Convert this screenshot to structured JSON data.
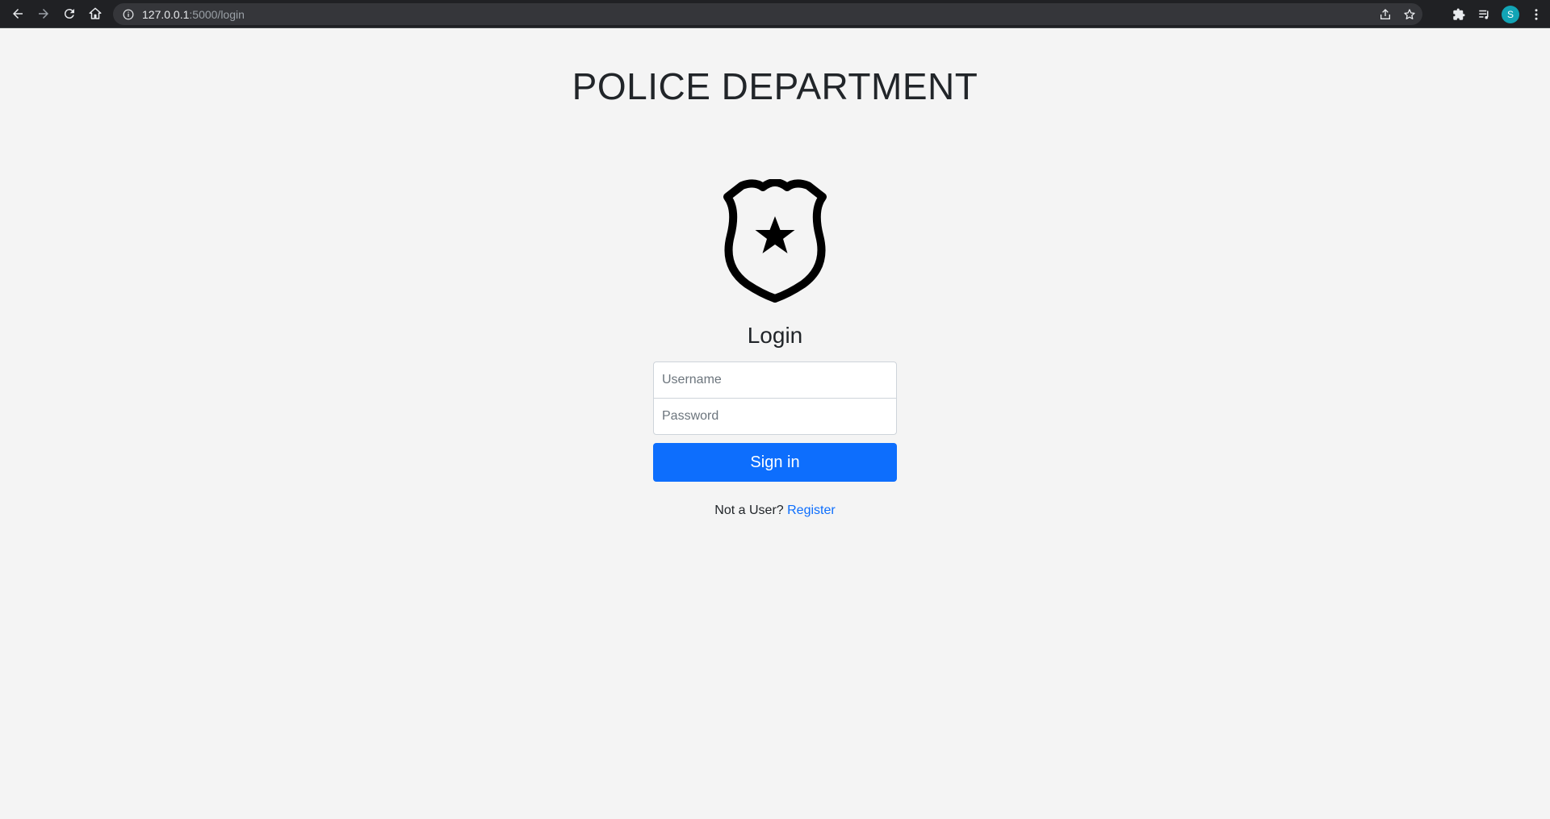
{
  "browser": {
    "url_host": "127.0.0.1",
    "url_path": ":5000/login",
    "profile_initial": "S",
    "icons": [
      "back-icon",
      "forward-icon",
      "reload-icon",
      "home-icon",
      "info-icon",
      "share-icon",
      "star-icon",
      "extensions-icon",
      "media-icon",
      "menu-icon"
    ]
  },
  "page": {
    "title": "POLICE DEPARTMENT",
    "logo_icon": "police-badge-icon",
    "login_heading": "Login",
    "username_placeholder": "Username",
    "password_placeholder": "Password",
    "signin_label": "Sign in",
    "register_prompt": "Not a User?",
    "register_link": "Register"
  },
  "colors": {
    "primary": "#0d6efd",
    "background": "#f4f4f4",
    "chrome": "#202124",
    "avatar": "#12a4b5"
  }
}
